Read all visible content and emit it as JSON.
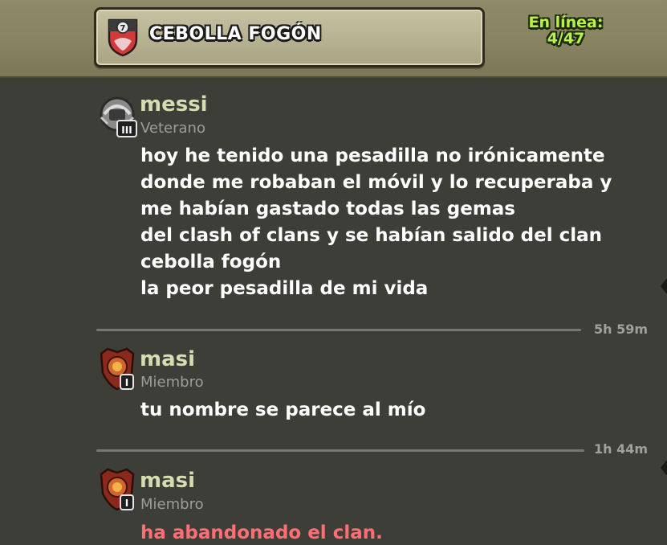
{
  "header": {
    "clan_level": "7",
    "clan_name": "CEBOLLA FOGÓN",
    "online_label": "En línea:",
    "online_count": "4/47"
  },
  "messages": [
    {
      "author": "messi",
      "role": "Veterano",
      "rank": "III",
      "avatar_icon": "veteran-helmet-icon",
      "lines": [
        "hoy he tenido una pesadilla no irónicamente",
        "donde me robaban el móvil y lo recuperaba y",
        "me habían gastado todas las gemas",
        "del clash of clans y se habían salido del clan",
        "cebolla fogón",
        "la peor pesadilla de mi vida"
      ],
      "time": "5h 59m"
    },
    {
      "author": "masi",
      "role": "Miembro",
      "rank": "I",
      "avatar_icon": "member-shield-icon",
      "lines": [
        "tu nombre se parece al mío"
      ],
      "time": "1h 44m"
    },
    {
      "author": "masi",
      "role": "Miembro",
      "rank": "I",
      "avatar_icon": "member-shield-icon",
      "event": "ha abandonado el clan."
    }
  ],
  "colors": {
    "chat_background": "#3d3e38",
    "author_name": "#d6dcb0",
    "online_text": "#b9f04a",
    "leave_event": "#ff6f73"
  }
}
